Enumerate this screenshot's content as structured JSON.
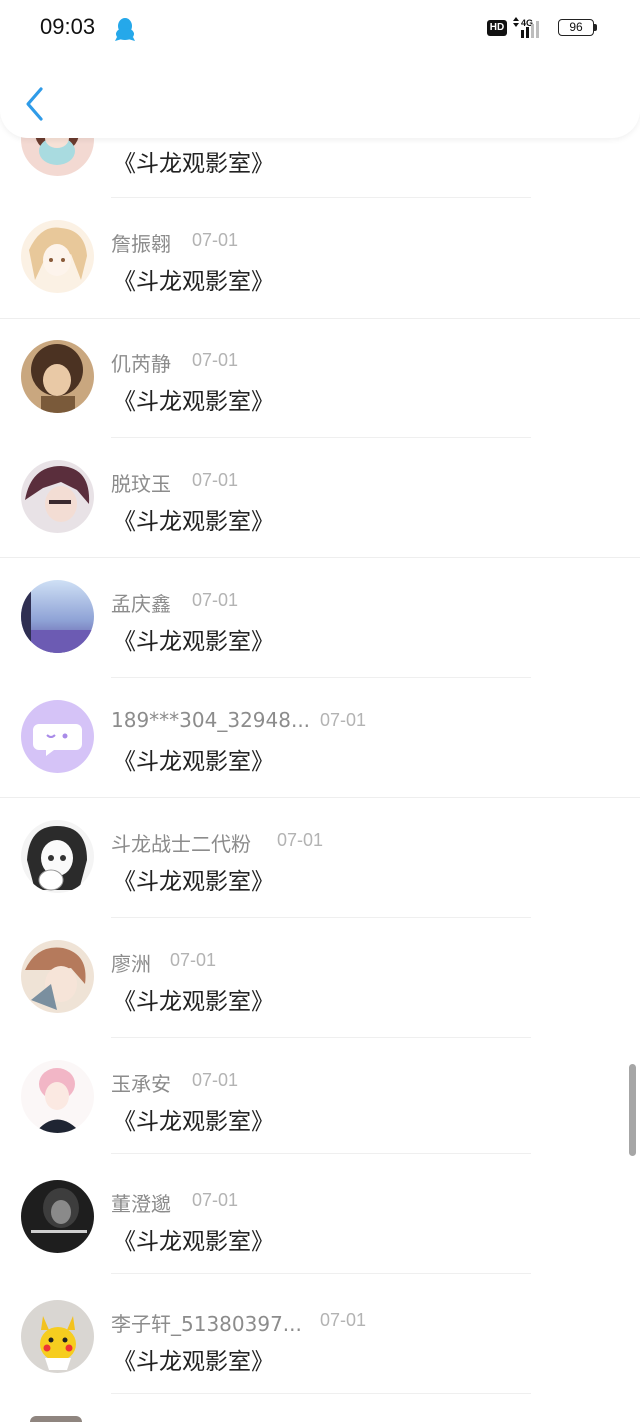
{
  "status_bar": {
    "time": "09:03",
    "hd": "HD",
    "network": "4G",
    "battery": "96"
  },
  "header": {
    "back_icon": "chevron-left-icon"
  },
  "colors": {
    "accent": "#2f9be8",
    "name_gray": "#8c8c8c",
    "date_gray": "#b3b3b3"
  },
  "items": [
    {
      "name": "",
      "date": "",
      "message": "《斗龙观影室》"
    },
    {
      "name": "詹振翱",
      "date": "07-01",
      "message": "《斗龙观影室》"
    },
    {
      "name": "仉芮静",
      "date": "07-01",
      "message": "《斗龙观影室》"
    },
    {
      "name": "脱玟玉",
      "date": "07-01",
      "message": "《斗龙观影室》"
    },
    {
      "name": "孟庆鑫",
      "date": "07-01",
      "message": "《斗龙观影室》"
    },
    {
      "name": "189***304_32948...",
      "date": "07-01",
      "message": "《斗龙观影室》"
    },
    {
      "name": "斗龙战士二代粉",
      "date": "07-01",
      "message": "《斗龙观影室》"
    },
    {
      "name": "廖洲",
      "date": "07-01",
      "message": "《斗龙观影室》"
    },
    {
      "name": "玉承安",
      "date": "07-01",
      "message": "《斗龙观影室》"
    },
    {
      "name": "董澄邈",
      "date": "07-01",
      "message": "《斗龙观影室》"
    },
    {
      "name": "李子轩_51380397...",
      "date": "07-01",
      "message": "《斗龙观影室》"
    }
  ]
}
